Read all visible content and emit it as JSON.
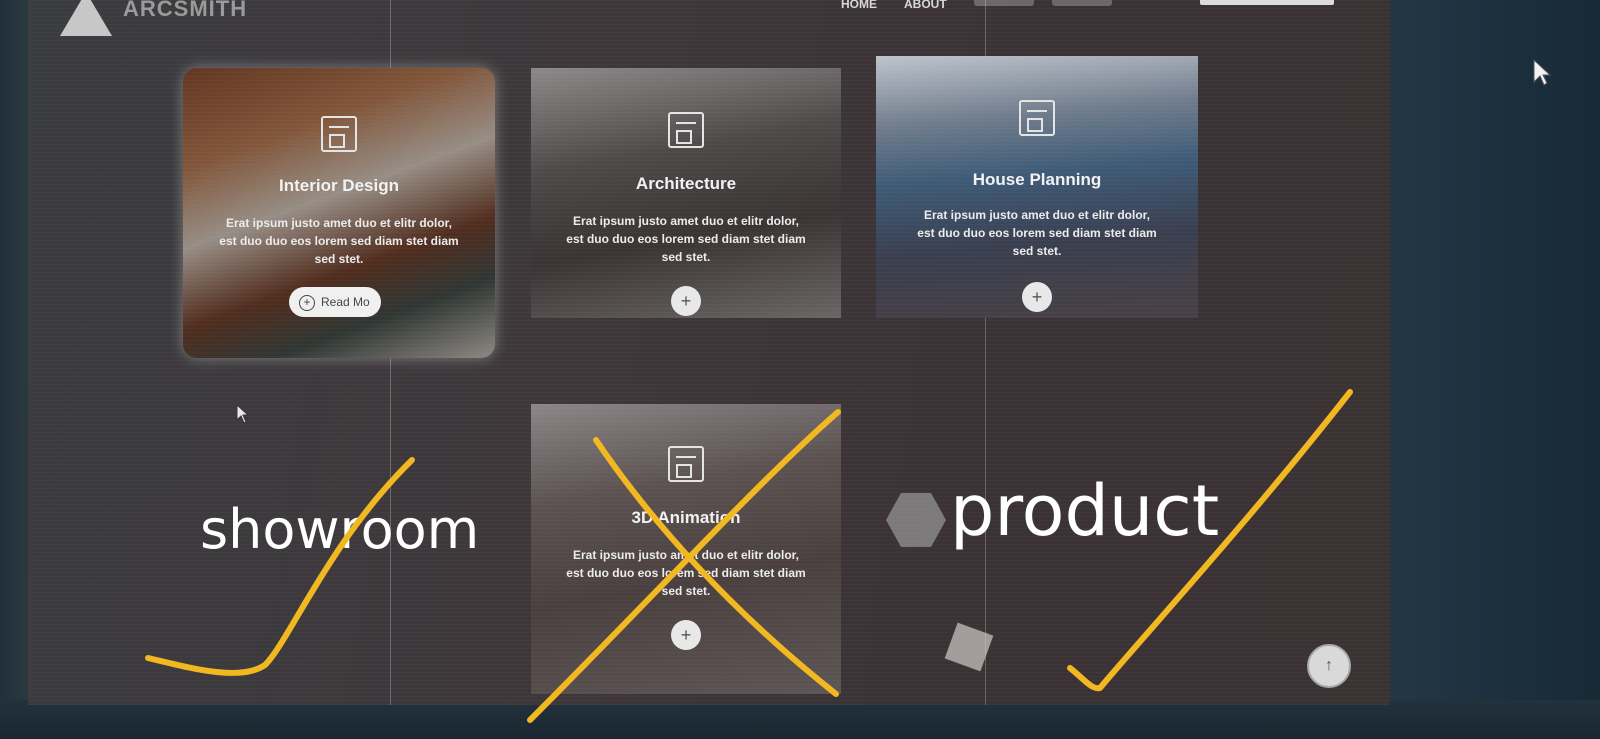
{
  "nav": {
    "logo_text": "ARCSMITH",
    "links": [
      "HOME",
      "ABOUT"
    ]
  },
  "cards": [
    {
      "title": "Interior Design",
      "text": "Erat ipsum justo amet duo et elitr dolor, est duo duo eos lorem sed diam stet diam sed stet.",
      "button": "Read Mo",
      "icon": "interior-design-icon"
    },
    {
      "title": "Architecture",
      "text": "Erat ipsum justo amet duo et elitr dolor, est duo duo eos lorem sed diam stet diam sed stet.",
      "button": "+",
      "icon": "architecture-icon"
    },
    {
      "title": "House Planning",
      "text": "Erat ipsum justo amet duo et elitr dolor, est duo duo eos lorem sed diam stet diam sed stet.",
      "button": "+",
      "icon": "house-planning-icon"
    },
    {
      "title": "3D Animation",
      "text": "Erat ipsum justo amet duo et elitr dolor, est duo duo eos lorem sed diam stet diam sed stet.",
      "button": "+",
      "icon": "3d-animation-icon"
    }
  ],
  "scroll_top_icon": "arrow-up-icon",
  "annotations": {
    "left_label": "showroom",
    "right_label": "product",
    "ink_color": "#f2b822"
  }
}
